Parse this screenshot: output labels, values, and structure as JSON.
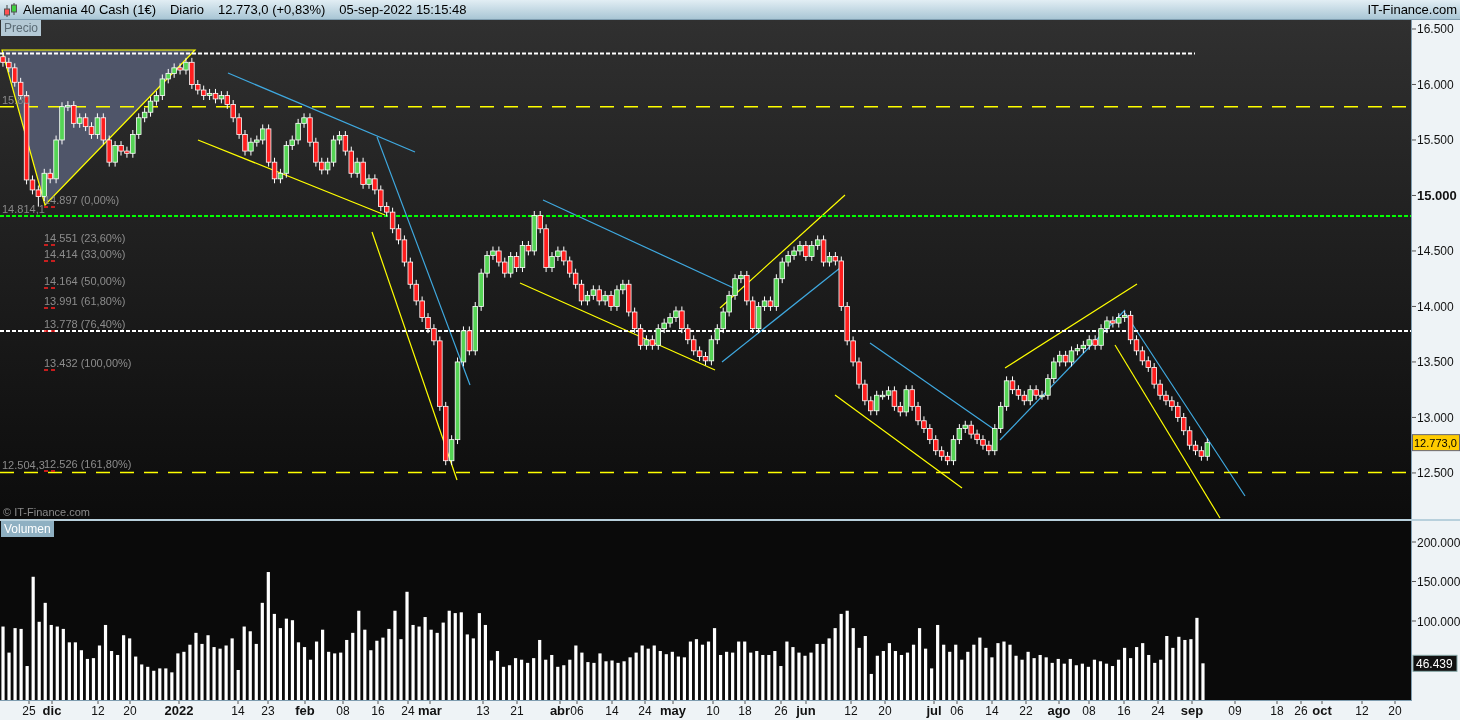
{
  "header": {
    "instrument": "Alemania 40 Cash (1€)",
    "period": "Diario",
    "quote": "12.773,0 (+0,83%)",
    "datetime": "05-sep-2022 15:15:48",
    "brand": "IT-Finance.com"
  },
  "price_pane": {
    "partial_level_label": "15.80",
    "watermark": "© IT-Finance.com",
    "last_price_badge": "12.773,0",
    "fibonacci_labels": [
      "14.897 (0,00%)",
      "14.551 (23,60%)",
      "14.414 (33,00%)",
      "14.164 (50,00%)",
      "13.991 (61,80%)",
      "13.778 (76,40%)",
      "13.432 (100,00%)",
      "12.526 (161,80%)"
    ],
    "chart_data": {
      "type": "candlestick",
      "title": "Precio",
      "ylim": [
        12085,
        16581
      ],
      "yticks": [
        {
          "value": 16500,
          "label": "16.500"
        },
        {
          "value": 16000,
          "label": "16.000"
        },
        {
          "value": 15500,
          "label": "15.500"
        },
        {
          "value": 15000,
          "label": "15.000"
        },
        {
          "value": 14500,
          "label": "14.500"
        },
        {
          "value": 14000,
          "label": "14.000"
        },
        {
          "value": 13500,
          "label": "13.500"
        },
        {
          "value": 13000,
          "label": "13.000"
        },
        {
          "value": 12500,
          "label": "12.500"
        }
      ],
      "ref_lines": [
        {
          "axis": "y",
          "value": 16280,
          "color": "#ffffff"
        },
        {
          "axis": "y",
          "value": 15800,
          "color": "#ffff00"
        },
        {
          "axis": "y",
          "value": 14814.1,
          "color": "#00ff00",
          "label": "14.814,1"
        },
        {
          "axis": "y",
          "value": 13778,
          "color": "#ffffff"
        },
        {
          "axis": "y",
          "value": 12504.3,
          "color": "#ffff00",
          "label": "12.504,3"
        }
      ],
      "ohlc": [
        [
          16250,
          16290,
          16160,
          16200
        ],
        [
          16200,
          16240,
          16110,
          16150
        ],
        [
          16150,
          16190,
          15980,
          16020
        ],
        [
          16020,
          16060,
          15860,
          15900
        ],
        [
          15900,
          15940,
          15100,
          15140
        ],
        [
          15140,
          15180,
          15010,
          15050
        ],
        [
          15050,
          15090,
          14900,
          14990
        ],
        [
          14990,
          15240,
          14950,
          15200
        ],
        [
          15200,
          15240,
          15110,
          15150
        ],
        [
          15150,
          15540,
          15110,
          15500
        ],
        [
          15500,
          15840,
          15460,
          15800
        ],
        [
          15800,
          15850,
          15760,
          15810
        ],
        [
          15810,
          15850,
          15610,
          15650
        ],
        [
          15650,
          15740,
          15610,
          15700
        ],
        [
          15700,
          15740,
          15580,
          15620
        ],
        [
          15620,
          15660,
          15510,
          15550
        ],
        [
          15550,
          15740,
          15510,
          15700
        ],
        [
          15700,
          15740,
          15460,
          15500
        ],
        [
          15500,
          15540,
          15260,
          15300
        ],
        [
          15300,
          15490,
          15260,
          15450
        ],
        [
          15450,
          15490,
          15360,
          15400
        ],
        [
          15400,
          15440,
          15340,
          15380
        ],
        [
          15380,
          15590,
          15340,
          15550
        ],
        [
          15550,
          15740,
          15510,
          15700
        ],
        [
          15700,
          15790,
          15660,
          15750
        ],
        [
          15750,
          15890,
          15710,
          15850
        ],
        [
          15850,
          15940,
          15810,
          15900
        ],
        [
          15900,
          16090,
          15860,
          16050
        ],
        [
          16050,
          16140,
          16010,
          16100
        ],
        [
          16100,
          16190,
          16060,
          16150
        ],
        [
          16150,
          16190,
          16090,
          16130
        ],
        [
          16130,
          16240,
          16090,
          16200
        ],
        [
          16200,
          16240,
          15960,
          16000
        ],
        [
          16000,
          16040,
          15910,
          15950
        ],
        [
          15950,
          15990,
          15860,
          15900
        ],
        [
          15900,
          15960,
          15860,
          15920
        ],
        [
          15920,
          15960,
          15830,
          15870
        ],
        [
          15870,
          15940,
          15830,
          15900
        ],
        [
          15900,
          15940,
          15780,
          15820
        ],
        [
          15820,
          15860,
          15660,
          15700
        ],
        [
          15700,
          15740,
          15510,
          15550
        ],
        [
          15550,
          15590,
          15360,
          15400
        ],
        [
          15400,
          15520,
          15360,
          15480
        ],
        [
          15480,
          15540,
          15440,
          15500
        ],
        [
          15500,
          15640,
          15460,
          15600
        ],
        [
          15600,
          15640,
          15260,
          15300
        ],
        [
          15300,
          15340,
          15110,
          15150
        ],
        [
          15150,
          15240,
          15110,
          15200
        ],
        [
          15200,
          15490,
          15160,
          15450
        ],
        [
          15450,
          15540,
          15410,
          15500
        ],
        [
          15500,
          15690,
          15460,
          15650
        ],
        [
          15650,
          15740,
          15610,
          15700
        ],
        [
          15700,
          15740,
          15440,
          15480
        ],
        [
          15480,
          15520,
          15260,
          15300
        ],
        [
          15300,
          15340,
          15190,
          15230
        ],
        [
          15230,
          15340,
          15190,
          15300
        ],
        [
          15300,
          15540,
          15260,
          15500
        ],
        [
          15500,
          15580,
          15460,
          15540
        ],
        [
          15540,
          15580,
          15360,
          15400
        ],
        [
          15400,
          15440,
          15160,
          15200
        ],
        [
          15200,
          15340,
          15160,
          15300
        ],
        [
          15300,
          15340,
          15060,
          15100
        ],
        [
          15100,
          15190,
          15060,
          15150
        ],
        [
          15150,
          15190,
          15010,
          15050
        ],
        [
          15050,
          15090,
          14860,
          14900
        ],
        [
          14900,
          14940,
          14810,
          14850
        ],
        [
          14850,
          14890,
          14660,
          14700
        ],
        [
          14700,
          14740,
          14560,
          14600
        ],
        [
          14600,
          14640,
          14360,
          14400
        ],
        [
          14400,
          14440,
          14160,
          14200
        ],
        [
          14200,
          14240,
          14010,
          14050
        ],
        [
          14050,
          14090,
          13860,
          13900
        ],
        [
          13900,
          13940,
          13760,
          13800
        ],
        [
          13800,
          13840,
          13650,
          13690
        ],
        [
          13690,
          13730,
          13060,
          13100
        ],
        [
          13100,
          13140,
          12570,
          12610
        ],
        [
          12610,
          12840,
          12570,
          12800
        ],
        [
          12800,
          13540,
          12760,
          13500
        ],
        [
          13500,
          13820,
          13460,
          13780
        ],
        [
          13780,
          13820,
          13560,
          13600
        ],
        [
          13600,
          14040,
          13560,
          14000
        ],
        [
          14000,
          14340,
          13960,
          14300
        ],
        [
          14300,
          14500,
          14260,
          14460
        ],
        [
          14460,
          14540,
          14420,
          14500
        ],
        [
          14500,
          14540,
          14360,
          14400
        ],
        [
          14400,
          14440,
          14260,
          14300
        ],
        [
          14300,
          14490,
          14260,
          14450
        ],
        [
          14450,
          14490,
          14310,
          14350
        ],
        [
          14350,
          14590,
          14310,
          14550
        ],
        [
          14550,
          14590,
          14460,
          14500
        ],
        [
          14500,
          14860,
          14460,
          14820
        ],
        [
          14820,
          14860,
          14660,
          14700
        ],
        [
          14700,
          14740,
          14310,
          14350
        ],
        [
          14350,
          14490,
          14310,
          14450
        ],
        [
          14450,
          14540,
          14410,
          14500
        ],
        [
          14500,
          14540,
          14370,
          14410
        ],
        [
          14410,
          14450,
          14260,
          14300
        ],
        [
          14300,
          14340,
          14160,
          14200
        ],
        [
          14200,
          14240,
          14010,
          14050
        ],
        [
          14050,
          14140,
          14010,
          14100
        ],
        [
          14100,
          14190,
          14060,
          14150
        ],
        [
          14150,
          14190,
          14010,
          14050
        ],
        [
          14050,
          14140,
          14010,
          14100
        ],
        [
          14100,
          14140,
          13960,
          14000
        ],
        [
          14000,
          14190,
          13960,
          14150
        ],
        [
          14150,
          14240,
          14110,
          14200
        ],
        [
          14200,
          14240,
          13910,
          13950
        ],
        [
          13950,
          13990,
          13760,
          13800
        ],
        [
          13800,
          13840,
          13610,
          13650
        ],
        [
          13650,
          13740,
          13610,
          13700
        ],
        [
          13700,
          13740,
          13610,
          13650
        ],
        [
          13650,
          13840,
          13610,
          13800
        ],
        [
          13800,
          13890,
          13760,
          13850
        ],
        [
          13850,
          13940,
          13810,
          13900
        ],
        [
          13900,
          14000,
          13860,
          13960
        ],
        [
          13960,
          14000,
          13760,
          13800
        ],
        [
          13800,
          13840,
          13660,
          13700
        ],
        [
          13700,
          13740,
          13560,
          13600
        ],
        [
          13600,
          13640,
          13510,
          13550
        ],
        [
          13550,
          13590,
          13470,
          13510
        ],
        [
          13510,
          13740,
          13470,
          13700
        ],
        [
          13700,
          13840,
          13660,
          13800
        ],
        [
          13800,
          13990,
          13760,
          13950
        ],
        [
          13950,
          14140,
          13910,
          14100
        ],
        [
          14100,
          14290,
          14060,
          14250
        ],
        [
          14250,
          14320,
          14210,
          14280
        ],
        [
          14280,
          14320,
          14010,
          14050
        ],
        [
          14050,
          14090,
          13760,
          13800
        ],
        [
          13800,
          14040,
          13760,
          14000
        ],
        [
          14000,
          14090,
          13960,
          14050
        ],
        [
          14050,
          14090,
          13960,
          14000
        ],
        [
          14000,
          14290,
          13960,
          14250
        ],
        [
          14250,
          14440,
          14210,
          14400
        ],
        [
          14400,
          14500,
          14360,
          14460
        ],
        [
          14460,
          14540,
          14420,
          14500
        ],
        [
          14500,
          14590,
          14460,
          14550
        ],
        [
          14550,
          14590,
          14410,
          14450
        ],
        [
          14450,
          14590,
          14410,
          14550
        ],
        [
          14550,
          14640,
          14510,
          14600
        ],
        [
          14600,
          14640,
          14360,
          14400
        ],
        [
          14400,
          14490,
          14360,
          14450
        ],
        [
          14450,
          14490,
          14370,
          14410
        ],
        [
          14410,
          14450,
          13960,
          14000
        ],
        [
          14000,
          14040,
          13650,
          13690
        ],
        [
          13690,
          13730,
          13460,
          13500
        ],
        [
          13500,
          13540,
          13260,
          13300
        ],
        [
          13300,
          13340,
          13110,
          13150
        ],
        [
          13150,
          13190,
          13020,
          13060
        ],
        [
          13060,
          13240,
          13020,
          13200
        ],
        [
          13200,
          13240,
          13160,
          13200
        ],
        [
          13200,
          13280,
          13160,
          13240
        ],
        [
          13240,
          13280,
          13060,
          13100
        ],
        [
          13100,
          13140,
          13010,
          13050
        ],
        [
          13050,
          13290,
          13010,
          13250
        ],
        [
          13250,
          13290,
          13060,
          13100
        ],
        [
          13100,
          13140,
          12930,
          12970
        ],
        [
          12970,
          13010,
          12860,
          12900
        ],
        [
          12900,
          12940,
          12760,
          12800
        ],
        [
          12800,
          12840,
          12660,
          12700
        ],
        [
          12700,
          12740,
          12610,
          12650
        ],
        [
          12650,
          12690,
          12570,
          12610
        ],
        [
          12610,
          12840,
          12570,
          12800
        ],
        [
          12800,
          12940,
          12760,
          12900
        ],
        [
          12900,
          12970,
          12860,
          12930
        ],
        [
          12930,
          12970,
          12810,
          12850
        ],
        [
          12850,
          12890,
          12760,
          12800
        ],
        [
          12800,
          12840,
          12710,
          12750
        ],
        [
          12750,
          12790,
          12660,
          12700
        ],
        [
          12700,
          12940,
          12660,
          12900
        ],
        [
          12900,
          13140,
          12860,
          13100
        ],
        [
          13100,
          13370,
          13060,
          13330
        ],
        [
          13330,
          13370,
          13210,
          13250
        ],
        [
          13250,
          13290,
          13160,
          13200
        ],
        [
          13200,
          13240,
          13110,
          13150
        ],
        [
          13150,
          13290,
          13110,
          13250
        ],
        [
          13250,
          13290,
          13160,
          13200
        ],
        [
          13200,
          13240,
          13160,
          13200
        ],
        [
          13200,
          13390,
          13160,
          13350
        ],
        [
          13350,
          13540,
          13310,
          13500
        ],
        [
          13500,
          13600,
          13460,
          13560
        ],
        [
          13560,
          13600,
          13460,
          13500
        ],
        [
          13500,
          13640,
          13460,
          13600
        ],
        [
          13600,
          13660,
          13560,
          13620
        ],
        [
          13620,
          13690,
          13580,
          13650
        ],
        [
          13650,
          13740,
          13610,
          13700
        ],
        [
          13700,
          13740,
          13610,
          13650
        ],
        [
          13650,
          13840,
          13610,
          13800
        ],
        [
          13800,
          13910,
          13760,
          13870
        ],
        [
          13870,
          13910,
          13810,
          13850
        ],
        [
          13850,
          13940,
          13810,
          13900
        ],
        [
          13900,
          13960,
          13860,
          13920
        ],
        [
          13920,
          13960,
          13660,
          13700
        ],
        [
          13700,
          13740,
          13560,
          13600
        ],
        [
          13600,
          13640,
          13470,
          13510
        ],
        [
          13510,
          13550,
          13410,
          13450
        ],
        [
          13450,
          13490,
          13260,
          13300
        ],
        [
          13300,
          13340,
          13160,
          13200
        ],
        [
          13200,
          13240,
          13110,
          13150
        ],
        [
          13150,
          13190,
          13060,
          13100
        ],
        [
          13100,
          13140,
          12960,
          13000
        ],
        [
          13000,
          13040,
          12840,
          12880
        ],
        [
          12880,
          12920,
          12710,
          12750
        ],
        [
          12750,
          12790,
          12660,
          12700
        ],
        [
          12700,
          12740,
          12610,
          12650
        ],
        [
          12650,
          12810,
          12610,
          12773
        ],
        null,
        null,
        null,
        null,
        null,
        null,
        null,
        null,
        null,
        null,
        null,
        null,
        null,
        null,
        null,
        null,
        null,
        null,
        null,
        null,
        null,
        null,
        null,
        null,
        null,
        null,
        null,
        null,
        null,
        null,
        null,
        null,
        null,
        null
      ]
    }
  },
  "volume_pane": {
    "last_volume_badge": "46.439",
    "chart_data": {
      "type": "bar",
      "title": "Volumen",
      "ylim": [
        0,
        226600
      ],
      "yticks": [
        {
          "value": 200000,
          "label": "200.000"
        },
        {
          "value": 150000,
          "label": "150.000"
        },
        {
          "value": 100000,
          "label": "100.000"
        }
      ],
      "values": [
        93000,
        60000,
        91000,
        90000,
        43000,
        156000,
        99000,
        123000,
        95000,
        93000,
        90000,
        73000,
        73000,
        63000,
        52000,
        53000,
        69000,
        95000,
        62000,
        57000,
        82000,
        78000,
        55000,
        45000,
        42000,
        37000,
        40000,
        40000,
        35000,
        59000,
        61000,
        70000,
        85000,
        71000,
        82000,
        67000,
        65000,
        69000,
        78000,
        38000,
        93000,
        87000,
        71000,
        123000,
        162000,
        109000,
        91000,
        103000,
        101000,
        73000,
        67000,
        51000,
        74000,
        89000,
        61000,
        59000,
        60000,
        76000,
        85000,
        113000,
        89000,
        63000,
        75000,
        79000,
        90000,
        113000,
        77000,
        137000,
        95000,
        93000,
        105000,
        89000,
        85000,
        98000,
        113000,
        110000,
        111000,
        83000,
        78000,
        110000,
        95000,
        50000,
        62000,
        42000,
        44000,
        53000,
        51000,
        47000,
        53000,
        76000,
        51000,
        57000,
        42000,
        44000,
        51000,
        69000,
        60000,
        48000,
        47000,
        59000,
        49000,
        50000,
        47000,
        49000,
        54000,
        60000,
        69000,
        65000,
        69000,
        62000,
        58000,
        61000,
        55000,
        54000,
        74000,
        77000,
        70000,
        74000,
        91000,
        57000,
        61000,
        60000,
        74000,
        74000,
        60000,
        62000,
        57000,
        57000,
        62000,
        43000,
        74000,
        67000,
        60000,
        56000,
        60000,
        71000,
        71000,
        78000,
        91000,
        109000,
        113000,
        91000,
        66000,
        81000,
        33000,
        56000,
        62000,
        72000,
        62000,
        57000,
        60000,
        70000,
        91000,
        65000,
        40000,
        95000,
        70000,
        61000,
        70000,
        51000,
        61000,
        70000,
        79000,
        66000,
        54000,
        72000,
        74000,
        70000,
        56000,
        51000,
        61000,
        53000,
        57000,
        54000,
        47000,
        52000,
        46000,
        52000,
        44000,
        46000,
        42000,
        51000,
        49000,
        46000,
        43000,
        51000,
        66000,
        53000,
        67000,
        72000,
        57000,
        47000,
        51000,
        81000,
        66000,
        80000,
        76000,
        77000,
        104000,
        46439,
        null,
        null,
        null,
        null,
        null,
        null,
        null,
        null,
        null,
        null,
        null,
        null,
        null,
        null,
        null,
        null,
        null,
        null,
        null,
        null,
        null,
        null,
        null,
        null,
        null,
        null,
        null,
        null,
        null,
        null,
        null,
        null,
        null,
        null
      ]
    }
  },
  "date_axis": [
    {
      "text": "25",
      "kind": "day"
    },
    {
      "text": "dic",
      "kind": "month"
    },
    {
      "text": "12",
      "kind": "day"
    },
    {
      "text": "20",
      "kind": "day"
    },
    {
      "text": "2022",
      "kind": "month"
    },
    {
      "text": "14",
      "kind": "day"
    },
    {
      "text": "23",
      "kind": "day"
    },
    {
      "text": "feb",
      "kind": "month"
    },
    {
      "text": "08",
      "kind": "day"
    },
    {
      "text": "16",
      "kind": "day"
    },
    {
      "text": "24",
      "kind": "day"
    },
    {
      "text": "mar",
      "kind": "month"
    },
    {
      "text": "13",
      "kind": "day"
    },
    {
      "text": "21",
      "kind": "day"
    },
    {
      "text": "abr",
      "kind": "month"
    },
    {
      "text": "06",
      "kind": "day"
    },
    {
      "text": "14",
      "kind": "day"
    },
    {
      "text": "24",
      "kind": "day"
    },
    {
      "text": "may",
      "kind": "month"
    },
    {
      "text": "10",
      "kind": "day"
    },
    {
      "text": "18",
      "kind": "day"
    },
    {
      "text": "26",
      "kind": "day"
    },
    {
      "text": "jun",
      "kind": "month"
    },
    {
      "text": "12",
      "kind": "day"
    },
    {
      "text": "20",
      "kind": "day"
    },
    {
      "text": "jul",
      "kind": "month"
    },
    {
      "text": "06",
      "kind": "day"
    },
    {
      "text": "14",
      "kind": "day"
    },
    {
      "text": "22",
      "kind": "day"
    },
    {
      "text": "ago",
      "kind": "month"
    },
    {
      "text": "08",
      "kind": "day"
    },
    {
      "text": "16",
      "kind": "day"
    },
    {
      "text": "24",
      "kind": "day"
    },
    {
      "text": "sep",
      "kind": "month"
    },
    {
      "text": "09",
      "kind": "day"
    },
    {
      "text": "18",
      "kind": "day"
    },
    {
      "text": "26",
      "kind": "day"
    },
    {
      "text": "oct",
      "kind": "month"
    },
    {
      "text": "12",
      "kind": "day"
    },
    {
      "text": "20",
      "kind": "day"
    }
  ]
}
